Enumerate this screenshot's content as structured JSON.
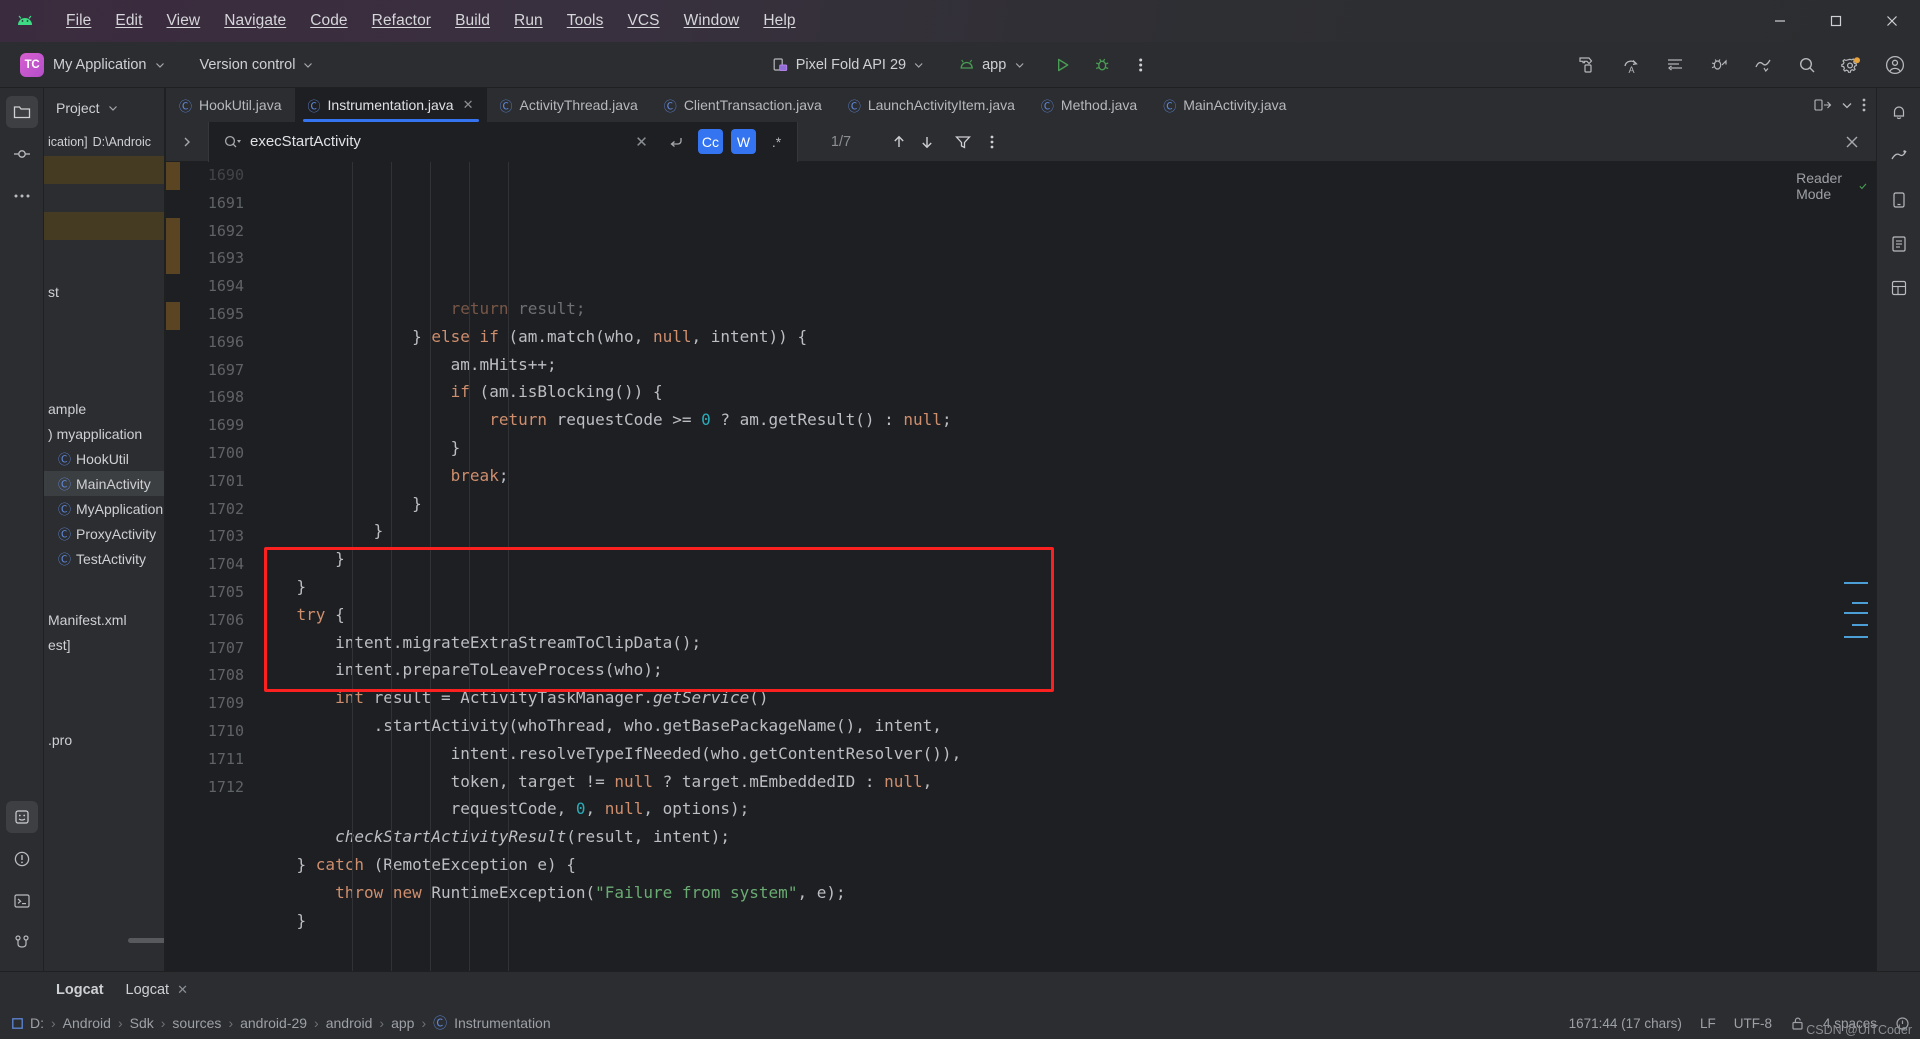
{
  "window": {
    "app_icon": "android-logo-icon",
    "menu": [
      "File",
      "Edit",
      "View",
      "Navigate",
      "Code",
      "Refactor",
      "Build",
      "Run",
      "Tools",
      "VCS",
      "Window",
      "Help"
    ],
    "controls": {
      "minimize": "minimize-icon",
      "maximize": "maximize-icon",
      "close": "close-icon"
    }
  },
  "toolbar": {
    "project_badge": "TC",
    "project_name": "My Application",
    "version_control": "Version control",
    "device": "Pixel Fold API 29",
    "run_config": "app",
    "run_label": "run-icon",
    "debug_label": "debug-icon",
    "more_label": "more-vertical-icon",
    "right_icons": [
      "build-hammer-icon",
      "code-with-me-icon",
      "updates-icon",
      "debug-attach-icon",
      "profiler-icon",
      "search-everywhere-icon",
      "settings-gear-icon",
      "account-avatar-icon"
    ]
  },
  "sidebar": {
    "title": "Project",
    "tool_icons_top": [
      "project-files-icon",
      "commit-icon",
      "more-tool-windows-icon"
    ],
    "tool_icons_bottom": [
      "resource-manager-icon",
      "problems-icon",
      "terminal-icon",
      "git-branch-icon"
    ],
    "path_label": "ication]",
    "path_value": "D:\\Androic",
    "partial_rows": [
      "st",
      "ample",
      "myapplication"
    ],
    "tree": [
      {
        "label": "HookUtil",
        "icon": "java-class-icon",
        "selected": false
      },
      {
        "label": "MainActivity",
        "icon": "java-class-icon",
        "selected": true
      },
      {
        "label": "MyApplication",
        "icon": "java-class-icon",
        "selected": false
      },
      {
        "label": "ProxyActivity",
        "icon": "java-class-icon",
        "selected": false
      },
      {
        "label": "TestActivity",
        "icon": "java-class-icon",
        "selected": false
      }
    ],
    "tail_rows": [
      "Manifest.xml",
      "est]",
      ".pro"
    ]
  },
  "tabs": [
    {
      "label": "HookUtil.java",
      "active": false,
      "closable": false
    },
    {
      "label": "Instrumentation.java",
      "active": true,
      "closable": true
    },
    {
      "label": "ActivityThread.java",
      "active": false,
      "closable": false
    },
    {
      "label": "ClientTransaction.java",
      "active": false,
      "closable": false
    },
    {
      "label": "LaunchActivityItem.java",
      "active": false,
      "closable": false
    },
    {
      "label": "Method.java",
      "active": false,
      "closable": false
    },
    {
      "label": "MainActivity.java",
      "active": false,
      "closable": false
    }
  ],
  "tabbar_right_icons": [
    "split-editor-icon",
    "chevron-down-icon",
    "more-vertical-icon"
  ],
  "find": {
    "expand_icon": "chevron-right-icon",
    "search_icon": "search-dropdown-icon",
    "query": "execStartActivity",
    "clear_icon": "close-icon",
    "regex_history_icon": "new-line-icon",
    "toggles": [
      {
        "label": "Cc",
        "name": "match-case-toggle",
        "on": true
      },
      {
        "label": "W",
        "name": "words-toggle",
        "on": true
      },
      {
        "label": ".*",
        "name": "regex-toggle",
        "on": false
      }
    ],
    "count": "1/7",
    "prev_icon": "arrow-up-icon",
    "next_icon": "arrow-down-icon",
    "filter_icon": "filter-icon",
    "more_icon": "more-vertical-icon",
    "close_icon": "close-icon"
  },
  "editor": {
    "reader_mode": "Reader Mode",
    "inspection_ok_icon": "checkmark-icon",
    "first_line_number": 1690,
    "lines": [
      {
        "no": 1690,
        "indent": 0,
        "tokens": [
          {
            "t": "                    ",
            "c": "m"
          },
          {
            "t": "return",
            "c": "k"
          },
          {
            "t": " result;",
            "c": "m"
          }
        ]
      },
      {
        "no": 1691,
        "indent": 0,
        "tokens": [
          {
            "t": "                ",
            "c": "m"
          },
          {
            "t": "} ",
            "c": "m"
          },
          {
            "t": "else if",
            "c": "k"
          },
          {
            "t": " (am.match(who, ",
            "c": "m"
          },
          {
            "t": "null",
            "c": "k"
          },
          {
            "t": ", intent)) {",
            "c": "m"
          }
        ]
      },
      {
        "no": 1692,
        "indent": 0,
        "tokens": [
          {
            "t": "                    am.mHits++;",
            "c": "m"
          }
        ]
      },
      {
        "no": 1693,
        "indent": 0,
        "tokens": [
          {
            "t": "                    ",
            "c": "m"
          },
          {
            "t": "if",
            "c": "k"
          },
          {
            "t": " (am.isBlocking()) {",
            "c": "m"
          }
        ]
      },
      {
        "no": 1694,
        "indent": 0,
        "tokens": [
          {
            "t": "                        ",
            "c": "m"
          },
          {
            "t": "return",
            "c": "k"
          },
          {
            "t": " requestCode >= ",
            "c": "m"
          },
          {
            "t": "0",
            "c": "n"
          },
          {
            "t": " ? am.getResult() : ",
            "c": "m"
          },
          {
            "t": "null",
            "c": "k"
          },
          {
            "t": ";",
            "c": "m"
          }
        ]
      },
      {
        "no": 1695,
        "indent": 0,
        "tokens": [
          {
            "t": "                    }",
            "c": "m"
          }
        ]
      },
      {
        "no": 1696,
        "indent": 0,
        "tokens": [
          {
            "t": "                    ",
            "c": "m"
          },
          {
            "t": "break",
            "c": "k"
          },
          {
            "t": ";",
            "c": "m"
          }
        ]
      },
      {
        "no": 1697,
        "indent": 0,
        "tokens": [
          {
            "t": "                }",
            "c": "m"
          }
        ]
      },
      {
        "no": 1698,
        "indent": 0,
        "tokens": [
          {
            "t": "            }",
            "c": "m"
          }
        ]
      },
      {
        "no": 1699,
        "indent": 0,
        "tokens": [
          {
            "t": "        }",
            "c": "m"
          }
        ]
      },
      {
        "no": 1700,
        "indent": 0,
        "tokens": [
          {
            "t": "    }",
            "c": "m"
          }
        ]
      },
      {
        "no": 1701,
        "indent": 0,
        "tokens": [
          {
            "t": "    ",
            "c": "m"
          },
          {
            "t": "try",
            "c": "k"
          },
          {
            "t": " {",
            "c": "m"
          }
        ]
      },
      {
        "no": 1702,
        "indent": 0,
        "tokens": [
          {
            "t": "        intent.migrateExtraStreamToClipData();",
            "c": "m"
          }
        ]
      },
      {
        "no": 1703,
        "indent": 0,
        "tokens": [
          {
            "t": "        intent.prepareToLeaveProcess(who);",
            "c": "m"
          }
        ]
      },
      {
        "no": 1704,
        "indent": 0,
        "tokens": [
          {
            "t": "        ",
            "c": "m"
          },
          {
            "t": "int",
            "c": "k"
          },
          {
            "t": " result = ActivityTaskManager.",
            "c": "m"
          },
          {
            "t": "getService",
            "c": "it"
          },
          {
            "t": "()",
            "c": "m"
          }
        ]
      },
      {
        "no": 1705,
        "indent": 0,
        "tokens": [
          {
            "t": "            .startActivity(whoThread, who.getBasePackageName(), intent,",
            "c": "m"
          }
        ]
      },
      {
        "no": 1706,
        "indent": 0,
        "tokens": [
          {
            "t": "                    intent.resolveTypeIfNeeded(who.getContentResolver()),",
            "c": "m"
          }
        ]
      },
      {
        "no": 1707,
        "indent": 0,
        "tokens": [
          {
            "t": "                    token, target != ",
            "c": "m"
          },
          {
            "t": "null",
            "c": "k"
          },
          {
            "t": " ? target.mEmbeddedID : ",
            "c": "m"
          },
          {
            "t": "null",
            "c": "k"
          },
          {
            "t": ",",
            "c": "m"
          }
        ]
      },
      {
        "no": 1708,
        "indent": 0,
        "tokens": [
          {
            "t": "                    requestCode, ",
            "c": "m"
          },
          {
            "t": "0",
            "c": "n"
          },
          {
            "t": ", ",
            "c": "m"
          },
          {
            "t": "null",
            "c": "k"
          },
          {
            "t": ", options);",
            "c": "m"
          }
        ]
      },
      {
        "no": 1709,
        "indent": 0,
        "tokens": [
          {
            "t": "        ",
            "c": "m"
          },
          {
            "t": "checkStartActivityResult",
            "c": "it"
          },
          {
            "t": "(result, intent);",
            "c": "m"
          }
        ]
      },
      {
        "no": 1710,
        "indent": 0,
        "tokens": [
          {
            "t": "    } ",
            "c": "m"
          },
          {
            "t": "catch",
            "c": "k"
          },
          {
            "t": " (RemoteException e) {",
            "c": "m"
          }
        ]
      },
      {
        "no": 1711,
        "indent": 0,
        "tokens": [
          {
            "t": "        ",
            "c": "m"
          },
          {
            "t": "throw new",
            "c": "k"
          },
          {
            "t": " RuntimeException(",
            "c": "m"
          },
          {
            "t": "\"Failure from system\"",
            "c": "s"
          },
          {
            "t": ", e);",
            "c": "m"
          }
        ]
      },
      {
        "no": 1712,
        "indent": 0,
        "tokens": [
          {
            "t": "    }",
            "c": "m"
          }
        ]
      }
    ],
    "annotation_box": {
      "name": "red-highlight-box",
      "color": "#fb2121",
      "from_line": 1704,
      "to_line": 1708
    }
  },
  "bottom": {
    "tool_label": "Logcat",
    "tab_label": "Logcat",
    "tab_close_icon": "close-icon"
  },
  "status": {
    "breadcrumb": [
      "D:",
      "Android",
      "Sdk",
      "sources",
      "android-29",
      "android",
      "app",
      "Instrumentation"
    ],
    "breadcrumb_last_icon": "java-class-icon",
    "caret": "1671:44 (17 chars)",
    "line_sep": "LF",
    "encoding": "UTF-8",
    "read_only_icon": "lock-open-icon",
    "indent": "4 spaces",
    "watermark": "CSDN @UITCoder"
  },
  "colors": {
    "bg": "#2b2d30",
    "editor_bg": "#1e1f22",
    "accent": "#3574f0",
    "keyword": "#cf8e6d",
    "string": "#6aab73",
    "number": "#2aacb8",
    "text": "#bcbec4",
    "highlight_red": "#fb2121",
    "tab_icon_blue": "#5f87d6",
    "green": "#499c54"
  }
}
